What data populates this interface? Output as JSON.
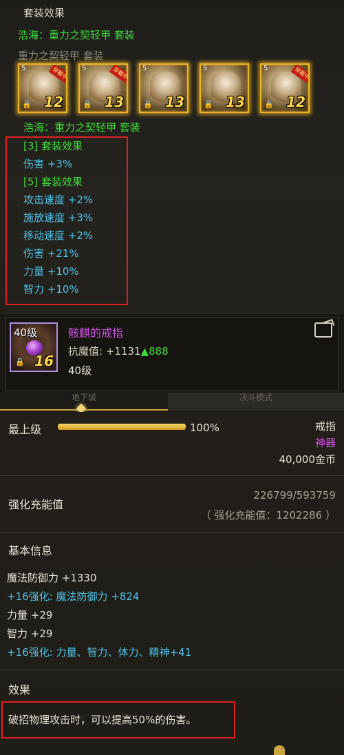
{
  "set_panel": {
    "header": "套装效果",
    "set_name_top": "浩海：重力之契轻甲 套装",
    "set_name_faded": "重力之契轻甲 套装",
    "items": [
      {
        "level": "12",
        "wearing_tag": "穿戴中",
        "slot_count": "5"
      },
      {
        "level": "13",
        "wearing_tag": "穿戴中",
        "slot_count": "5"
      },
      {
        "level": "13",
        "wearing_tag": "",
        "slot_count": "5"
      },
      {
        "level": "13",
        "wearing_tag": "",
        "slot_count": "5"
      },
      {
        "level": "12",
        "wearing_tag": "穿戴中",
        "slot_count": "5"
      }
    ],
    "set_name_bottom": "浩海：重力之契轻甲 套装",
    "effects": {
      "tier3_title": "[3] 套装效果",
      "tier3_damage": "伤害 +3%",
      "tier5_title": "[5] 套装效果",
      "tier5_attack_speed": "攻击速度 +2%",
      "tier5_cast_speed": "施放速度 +3%",
      "tier5_move_speed": "移动速度 +2%",
      "tier5_damage": "伤害 +21%",
      "tier5_strength": "力量 +10%",
      "tier5_intelligence": "智力 +10%"
    }
  },
  "item": {
    "level_tag": "40级",
    "icon_level": "16",
    "name": "骸麒的戒指",
    "magic_resist_label": "抗魔值:",
    "magic_resist_value": "+1131",
    "magic_resist_up": "▲888",
    "level_line": "40级"
  },
  "tabs": {
    "active": "地下城",
    "inactive": "决斗模式"
  },
  "detail": {
    "grade_label": "最上级",
    "grade_percent": "100%",
    "grade_fill": 1.0,
    "item_type": "戒指",
    "rarity": "神器",
    "price": "40,000金币",
    "charge_label": "强化充能值",
    "charge_value": "226799/593759",
    "charge_sub": "（ 强化充能值：1202286 ）",
    "basic_title": "基本信息",
    "stats": [
      {
        "text": "魔法防御力 +1330",
        "blue": false
      },
      {
        "text": "+16强化:  魔法防御力 +824",
        "blue": true
      },
      {
        "text": "力量 +29",
        "blue": false
      },
      {
        "text": "智力 +29",
        "blue": false
      },
      {
        "text": "+16强化:  力量、智力、体力、精神+41",
        "blue": true
      }
    ],
    "effect_title": "效果",
    "effect_text": "破招物理攻击时，可以提高50%的伤害。"
  },
  "colors": {
    "set_green": "#3fd93c",
    "stat_blue": "#4fc3e8",
    "artifact_pink": "#d04fe6",
    "highlight_red": "#e02020",
    "gold": "#e8b52a"
  }
}
